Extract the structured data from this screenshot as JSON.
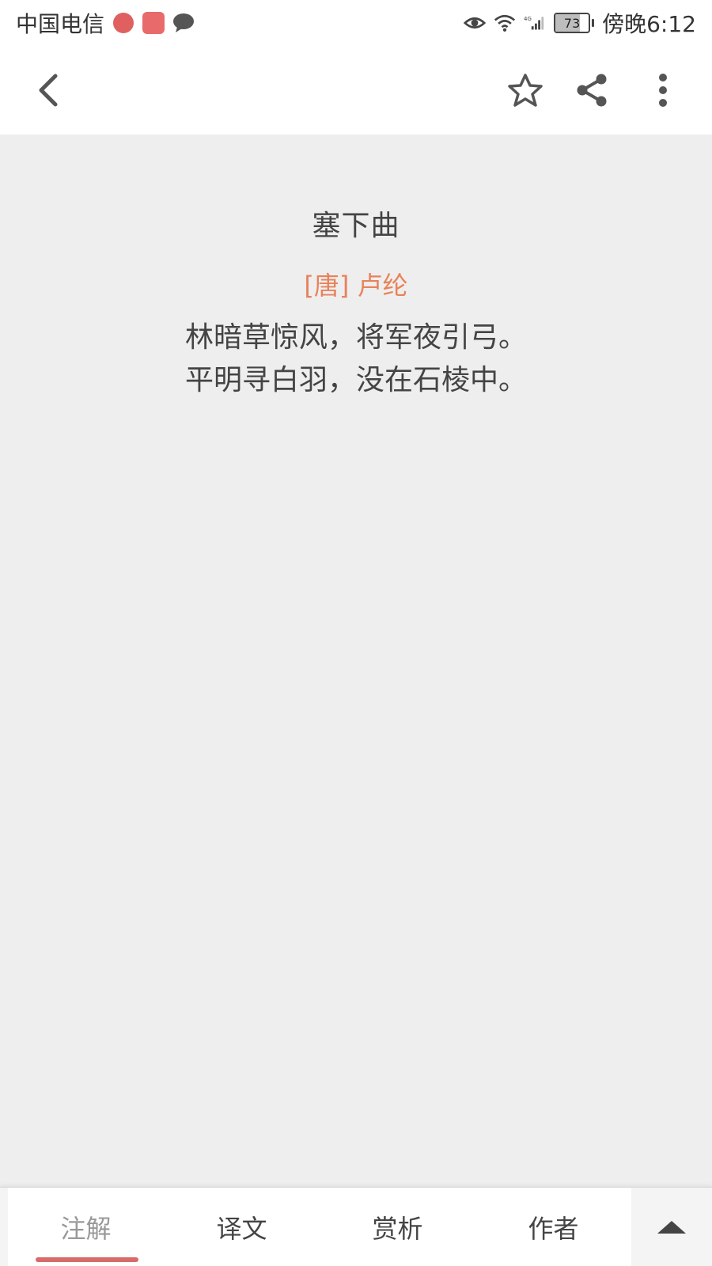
{
  "status_bar": {
    "carrier": "中国电信",
    "battery_level": "73",
    "battery_fraction": 0.73,
    "time": "傍晚6:12"
  },
  "toolbar": {
    "icons": [
      "back-icon",
      "star-icon",
      "share-icon",
      "more-icon"
    ]
  },
  "poem": {
    "title": "塞下曲",
    "author": "[唐] 卢纶",
    "lines": [
      "林暗草惊风，将军夜引弓。",
      "平明寻白羽，没在石棱中。"
    ]
  },
  "tabs": [
    {
      "label": "注解",
      "active": true
    },
    {
      "label": "译文",
      "active": false
    },
    {
      "label": "赏析",
      "active": false
    },
    {
      "label": "作者",
      "active": false
    }
  ],
  "colors": {
    "accent": "#e8825a",
    "underline": "#d86a6a",
    "background": "#eeeeee"
  }
}
